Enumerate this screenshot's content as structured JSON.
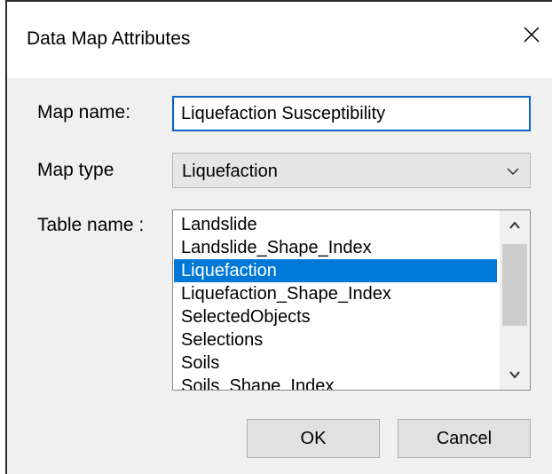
{
  "window": {
    "title": "Data Map Attributes"
  },
  "form": {
    "map_name_label": "Map name:",
    "map_name_value": "Liquefaction Susceptibility",
    "map_type_label": "Map type",
    "map_type_value": "Liquefaction",
    "table_name_label": "Table name :",
    "table_items": [
      "Landslide",
      "Landslide_Shape_Index",
      "Liquefaction",
      "Liquefaction_Shape_Index",
      "SelectedObjects",
      "Selections",
      "Soils",
      "Soils_Shape_Index"
    ],
    "table_selected": "Liquefaction"
  },
  "buttons": {
    "ok_label": "OK",
    "cancel_label": "Cancel"
  },
  "icons": {
    "close": "close-icon",
    "dropdown": "chevron-down-icon",
    "scroll_up": "chevron-up-icon",
    "scroll_down": "chevron-down-icon"
  },
  "colors": {
    "selection": "#0078d7",
    "focus_border": "#0a64c8",
    "dialog_bg": "#f0f0f0"
  }
}
